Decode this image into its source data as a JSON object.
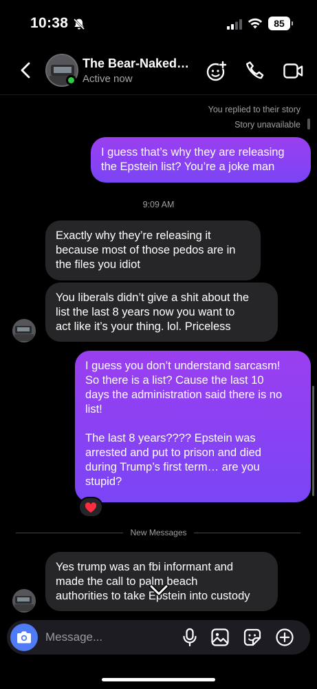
{
  "status_bar": {
    "time": "10:38",
    "battery": "85"
  },
  "header": {
    "contact_name": "The Bear-Naked…",
    "status": "Active now"
  },
  "story_reply": {
    "line1": "You replied to their story",
    "line2": "Story unavailable"
  },
  "messages": [
    {
      "id": "m1",
      "from": "me",
      "text": "I guess that’s why they are releasing\nthe Epstein list? You’re a joke man"
    },
    {
      "id": "t1",
      "type": "timestamp",
      "text": "9:09 AM"
    },
    {
      "id": "m2",
      "from": "them",
      "text": "Exactly why they’re releasing it\nbecause most of those pedos are in\nthe files you idiot"
    },
    {
      "id": "m3",
      "from": "them",
      "text": "You liberals didn’t give a shit about the\nlist the last 8 years now you want to\nact like it’s your thing. lol. Priceless"
    },
    {
      "id": "m4",
      "from": "me",
      "text": "I guess you don’t understand sarcasm!\nSo there is a list? Cause the last 10\ndays the administration said there is no\nlist!\n\nThe last 8 years???? Epstein was\narrested and put to prison and died\nduring Trump’s first term… are you\nstupid?",
      "reaction": "❤️"
    },
    {
      "id": "m5",
      "from": "them",
      "text": "Yes trump was an fbi informant and\nmade the call to palm beach\nauthorities to take Epstein into custody"
    }
  ],
  "divider_label": "New Messages",
  "composer": {
    "placeholder": "Message..."
  },
  "colors": {
    "bubble_mine_top": "#9a3ff0",
    "bubble_mine_bottom": "#7a45f5",
    "bubble_theirs": "#262628",
    "camera_button": "#4f7cf6",
    "online": "#2ecc40"
  },
  "icons": [
    "back-chevron-icon",
    "add-effect-icon",
    "phone-icon",
    "video-camera-icon",
    "camera-icon",
    "microphone-icon",
    "gallery-icon",
    "sticker-icon",
    "plus-circle-icon",
    "chevron-down-icon",
    "mute-bell-icon",
    "signal-icon",
    "wifi-icon"
  ]
}
